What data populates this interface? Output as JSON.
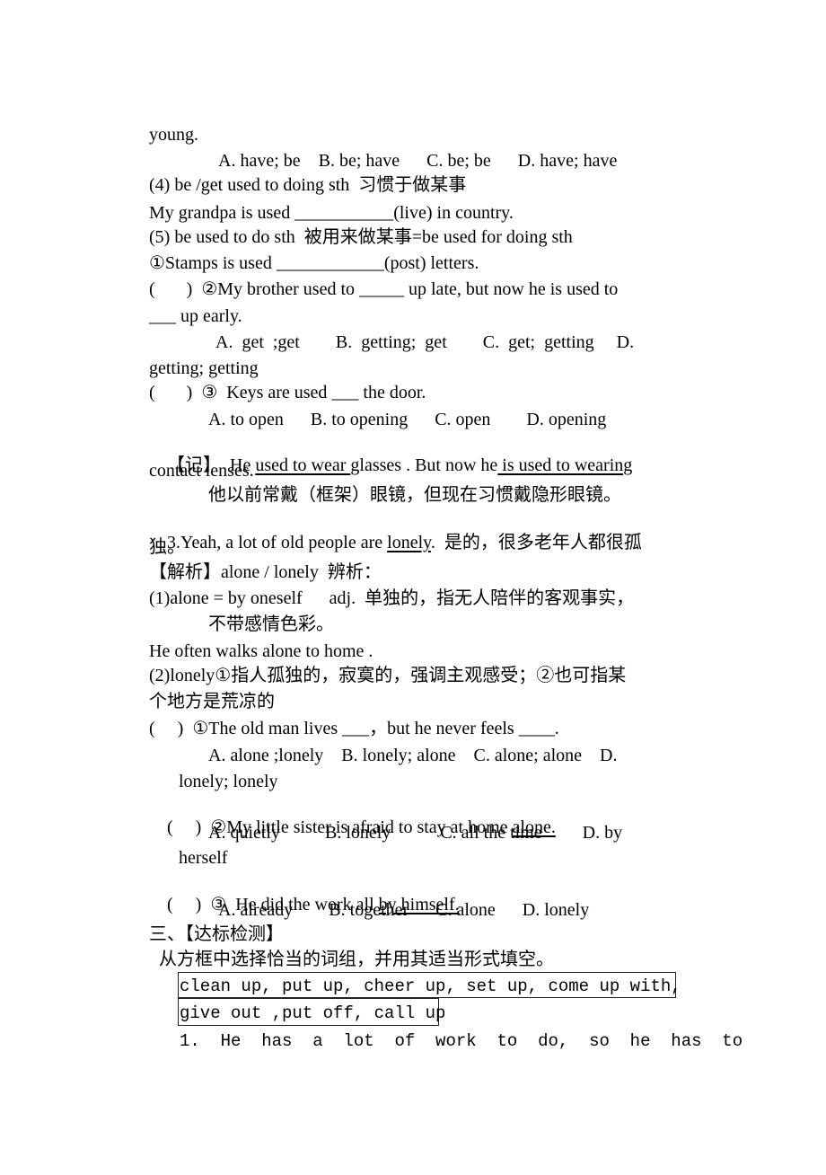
{
  "document": {
    "lines": {
      "l01": "young.",
      "l02": "A. have; be    B. be; have      C. be; be      D. have; have",
      "l03": "(4) be /get used to doing sth  习惯于做某事",
      "l04": "My grandpa is used ___________(live) in country.",
      "l05": "(5) be used to do sth  被用来做某事=be used for doing sth",
      "l06": "①Stamps is used ____________(post) letters.",
      "l07": "(       )  ②My brother used to _____ up late, but now he is used to",
      "l08": "___ up early.",
      "l09": "A.  get  ;get        B.  getting;  get        C.  get;  getting     D.",
      "l10": "getting; getting",
      "l11": "(       )  ③  Keys are used ___ the door.",
      "l12": "A. to open      B. to opening      C. open        D. opening",
      "l13a": "【记】  He ",
      "l13b": "used to wear ",
      "l13c": "glasses . But now he",
      "l13d": " is used to wearing",
      "l14": "contact lenses.",
      "l15": "他以前常戴（框架）眼镜，但现在习惯戴隐形眼镜。",
      "l16a": "3.Yeah, a lot of old people are ",
      "l16b": "lonely",
      "l16c": ".  是的，很多老年人都很孤",
      "l17": "独。",
      "l18": "【解析】alone / lonely  辨析：",
      "l19": "(1)alone = by oneself      adj.  单独的，指无人陪伴的客观事实，",
      "l20": "不带感情色彩。",
      "l21": "He often walks alone to home .",
      "l22": "(2)lonely①指人孤独的，寂寞的，强调主观感受；②也可指某",
      "l23": "个地方是荒凉的",
      "l24": "(     )  ①The old man lives ___，but he never feels ____.",
      "l25": "A. alone ;lonely    B. lonely; alone    C. alone; alone    D.",
      "l26": "lonely; lonely",
      "l27a": "(     )  ②My little sister is afraid to stay at home ",
      "l27b": "alone.",
      "l28": "A. quietly          B. lonely           C. all the time         D. by",
      "l29": "herself",
      "l30a": "(     )  ③  He did the work all ",
      "l30b": "by himself.",
      "l31": "A. already        B. together      C. alone      D. lonely",
      "l32": "三、【达标检测】",
      "l33": "从方框中选择恰当的词组，并用其适当形式填空。",
      "box1": "clean up, put up, cheer up, set up, come up with,",
      "box2": "give out ,put off, call up",
      "l34": "1.  He  has  a  lot  of  work  to  do,  so  he  has  to"
    }
  }
}
